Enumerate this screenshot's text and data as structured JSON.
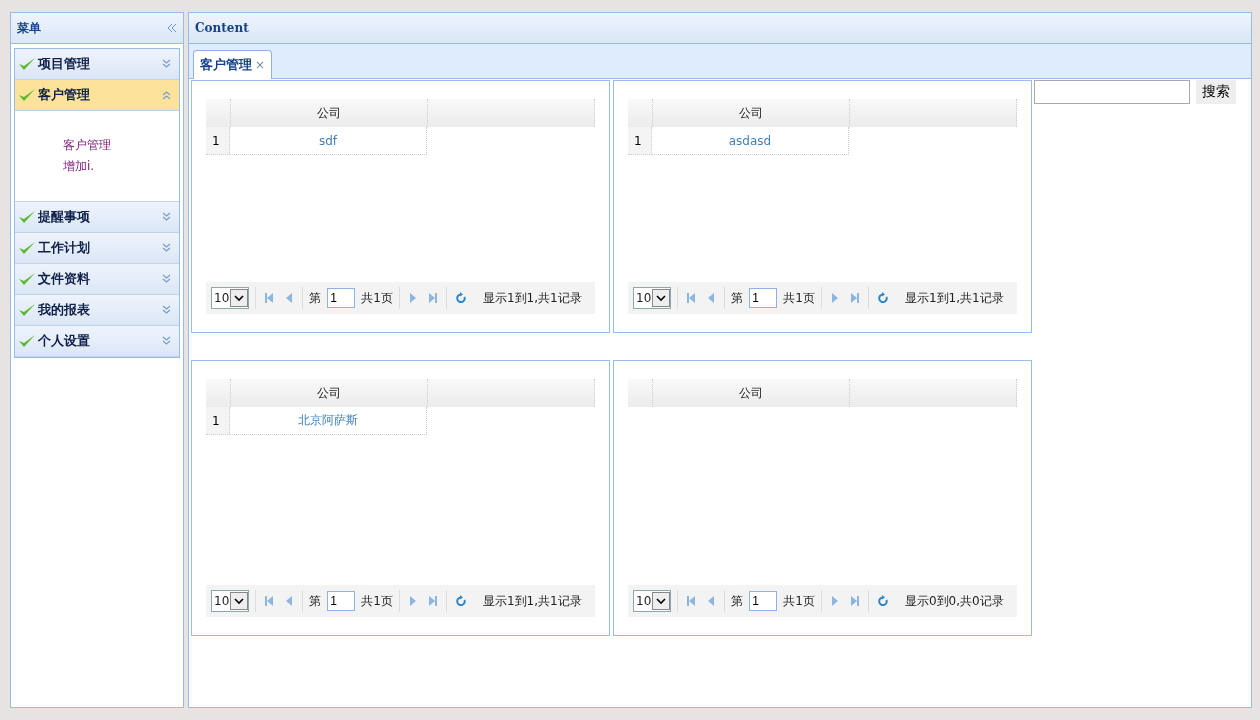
{
  "sidebar": {
    "title": "菜单",
    "items": [
      {
        "label": "项目管理",
        "expanded": false,
        "selected": false
      },
      {
        "label": "客户管理",
        "expanded": true,
        "selected": true,
        "children": [
          "客户管理",
          "增加i."
        ]
      },
      {
        "label": "提醒事项",
        "expanded": false,
        "selected": false
      },
      {
        "label": "工作计划",
        "expanded": false,
        "selected": false
      },
      {
        "label": "文件资料",
        "expanded": false,
        "selected": false
      },
      {
        "label": "我的报表",
        "expanded": false,
        "selected": false
      },
      {
        "label": "个人设置",
        "expanded": false,
        "selected": false
      }
    ]
  },
  "content": {
    "title": "Content",
    "tabs": [
      {
        "label": "客户管理",
        "close": "×",
        "selected": true
      }
    ],
    "grids": [
      {
        "column": "公司",
        "rows": [
          {
            "num": "1",
            "company": "sdf"
          }
        ],
        "page_size": "10",
        "page_prefix": "第",
        "page": "1",
        "page_total": "共1页",
        "summary": "显示1到1,共1记录"
      },
      {
        "column": "公司",
        "rows": [
          {
            "num": "1",
            "company": "asdasd"
          }
        ],
        "page_size": "10",
        "page_prefix": "第",
        "page": "1",
        "page_total": "共1页",
        "summary": "显示1到1,共1记录"
      },
      {
        "column": "公司",
        "rows": [
          {
            "num": "1",
            "company": "北京阿萨斯"
          }
        ],
        "page_size": "10",
        "page_prefix": "第",
        "page": "1",
        "page_total": "共1页",
        "summary": "显示1到1,共1记录"
      },
      {
        "column": "公司",
        "page_size": "10",
        "page_prefix": "第",
        "page": "1",
        "page_total": "共1页",
        "summary": "显示0到0,共0记录"
      }
    ],
    "search": {
      "button": "搜索"
    }
  }
}
